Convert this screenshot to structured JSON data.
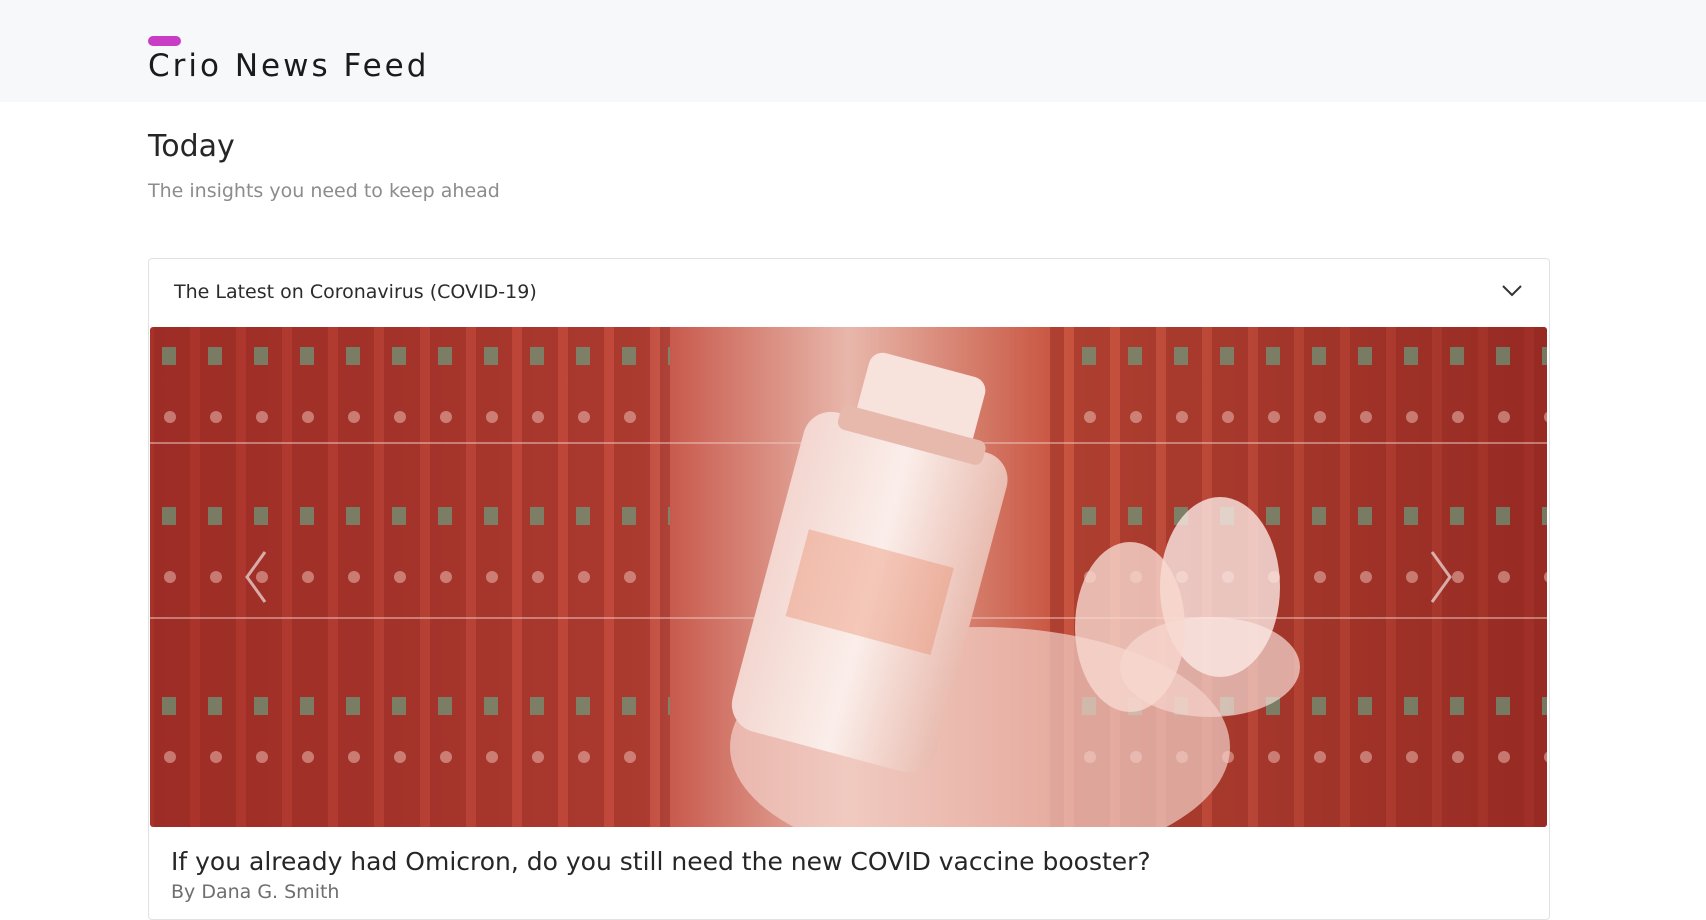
{
  "header": {
    "brand_title": "Crio News Feed",
    "accent_color": "#c93cc5"
  },
  "section": {
    "title": "Today",
    "subtitle": "The insights you need to keep ahead"
  },
  "accordion": {
    "title": "The Latest on Coronavirus (COVID-19)",
    "toggle_icon": "chevron-down-icon",
    "expanded": true
  },
  "carousel": {
    "prev_icon": "chevron-left-icon",
    "next_icon": "chevron-right-icon",
    "image_tint_color": "#b83a2c"
  },
  "article": {
    "title": "If you already had Omicron, do you still need the new COVID vaccine booster?",
    "author": "By Dana G. Smith"
  }
}
